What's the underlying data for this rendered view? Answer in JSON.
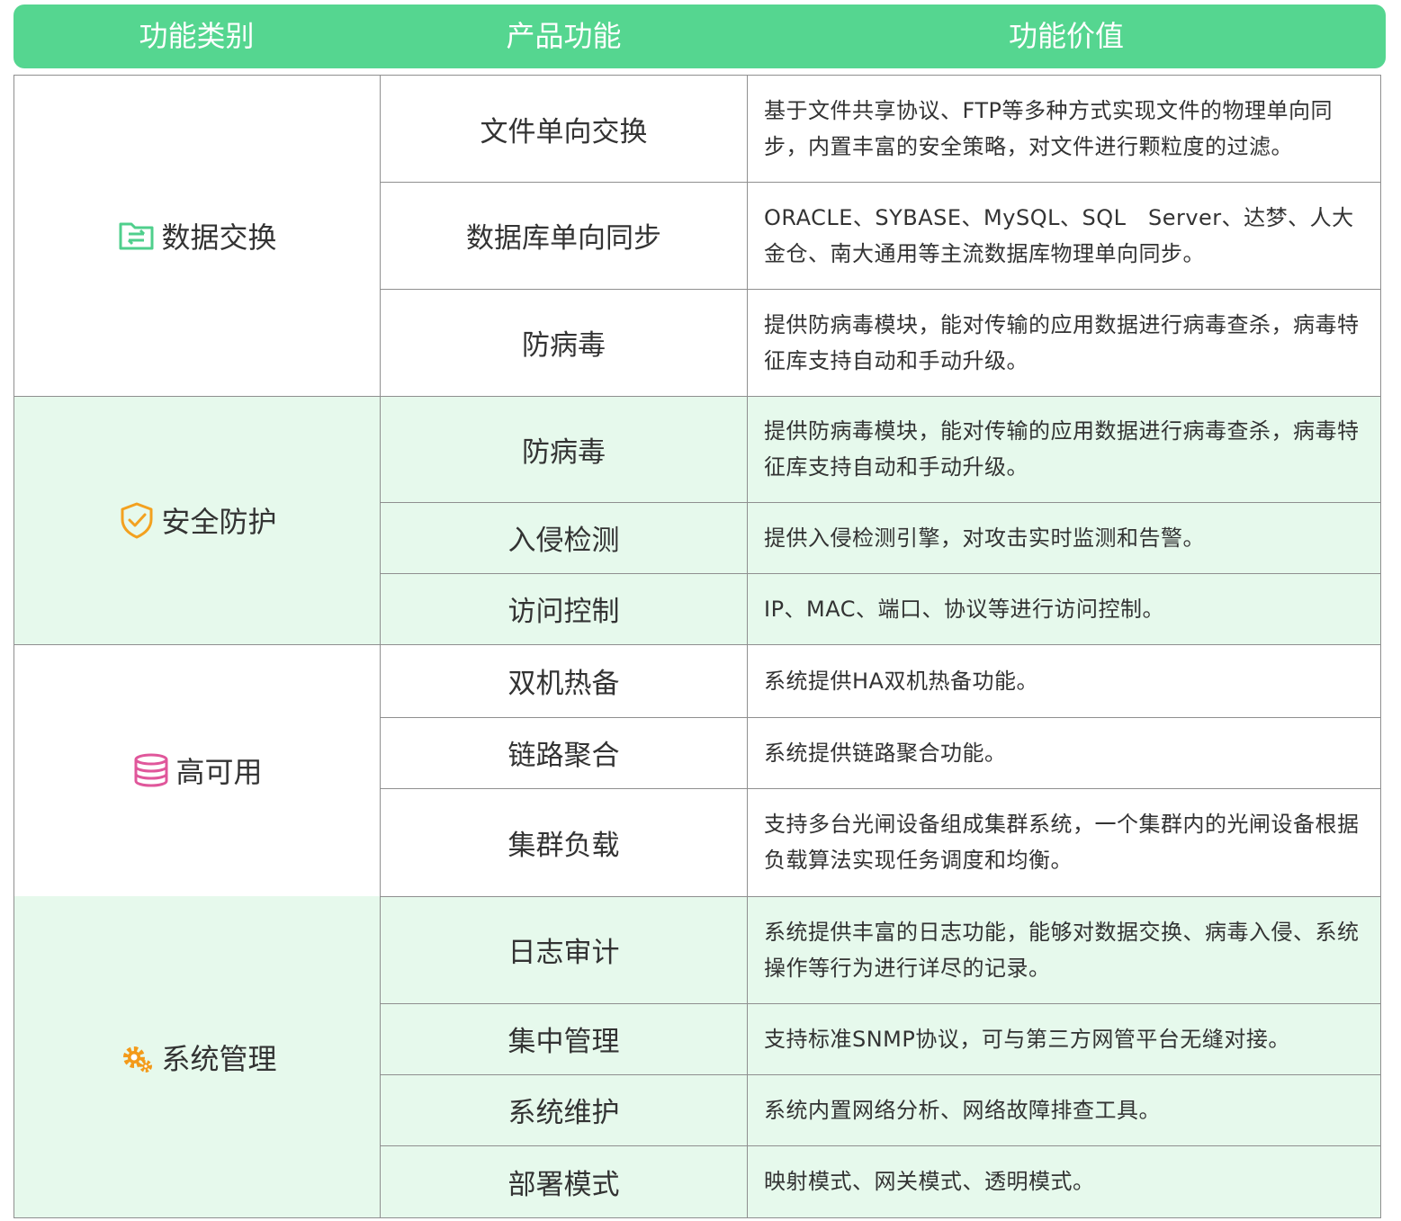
{
  "header": {
    "col1": "功能类别",
    "col2": "产品功能",
    "col3": "功能价值"
  },
  "colors": {
    "header_bg": "#55d690",
    "alt_row_bg": "#e6f9ec",
    "grid": "#8f8f8f"
  },
  "groups": [
    {
      "category": "数据交换",
      "icon": "folder-exchange-icon",
      "icon_color": "#4fcf8c",
      "rows": [
        {
          "feature": "文件单向交换",
          "value": "基于文件共享协议、FTP等多种方式实现文件的物理单向同步，内置丰富的安全策略，对文件进行颗粒度的过滤。"
        },
        {
          "feature": "数据库单向同步",
          "value": "ORACLE、SYBASE、MySQL、SQL　Server、达梦、人大金仓、南大通用等主流数据库物理单向同步。"
        },
        {
          "feature": "防病毒",
          "value": "提供防病毒模块，能对传输的应用数据进行病毒查杀，病毒特征库支持自动和手动升级。"
        }
      ]
    },
    {
      "category": "安全防护",
      "icon": "shield-check-icon",
      "icon_color": "#f3a11f",
      "rows": [
        {
          "feature": "防病毒",
          "value": "提供防病毒模块，能对传输的应用数据进行病毒查杀，病毒特征库支持自动和手动升级。"
        },
        {
          "feature": "入侵检测",
          "value": "提供入侵检测引擎，对攻击实时监测和告警。"
        },
        {
          "feature": "访问控制",
          "value": "IP、MAC、端口、协议等进行访问控制。"
        }
      ]
    },
    {
      "category": "高可用",
      "icon": "database-icon",
      "icon_color": "#e0579b",
      "rows": [
        {
          "feature": "双机热备",
          "value": "系统提供HA双机热备功能。"
        },
        {
          "feature": "链路聚合",
          "value": "系统提供链路聚合功能。"
        },
        {
          "feature": "集群负载",
          "value": "支持多台光闸设备组成集群系统，一个集群内的光闸设备根据负载算法实现任务调度和均衡。"
        }
      ]
    },
    {
      "category": "系统管理",
      "icon": "gears-icon",
      "icon_color": "#f39a1a",
      "rows": [
        {
          "feature": "日志审计",
          "value": "系统提供丰富的日志功能，能够对数据交换、病毒入侵、系统操作等行为进行详尽的记录。"
        },
        {
          "feature": "集中管理",
          "value": "支持标准SNMP协议，可与第三方网管平台无缝对接。"
        },
        {
          "feature": "系统维护",
          "value": "系统内置网络分析、网络故障排查工具。"
        },
        {
          "feature": "部署模式",
          "value": "映射模式、网关模式、透明模式。"
        }
      ]
    }
  ]
}
